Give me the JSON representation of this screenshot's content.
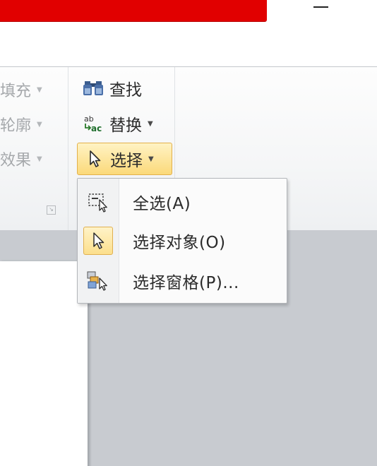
{
  "title_bar": {
    "minimize_label": "—"
  },
  "ribbon": {
    "shape_format": {
      "fill_label": "填充",
      "outline_label": "轮廓",
      "effects_label": "效果"
    },
    "editing": {
      "find_label": "查找",
      "replace_label": "替换",
      "select_label": "选择"
    }
  },
  "select_menu": {
    "items": [
      {
        "label": "全选(A)",
        "icon": "select-all-icon"
      },
      {
        "label": "选择对象(O)",
        "icon": "select-objects-icon",
        "checked": true
      },
      {
        "label": "选择窗格(P)...",
        "icon": "selection-pane-icon"
      }
    ]
  },
  "colors": {
    "title_red": "#e10000",
    "active_highlight": "#fbd97a",
    "workspace_gray": "#c8cbd0"
  }
}
